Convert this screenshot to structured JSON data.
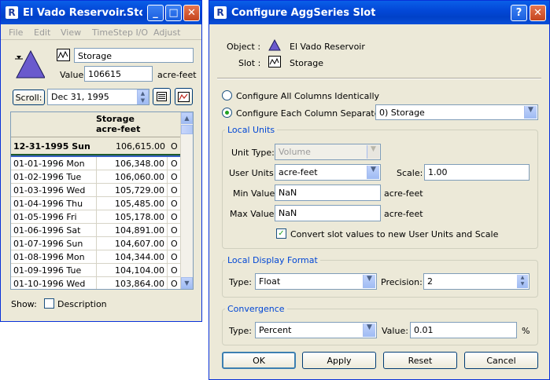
{
  "left_window": {
    "title": "El Vado Reservoir.Stor...",
    "menu": [
      "File",
      "Edit",
      "View",
      "TimeStep I/O",
      "Adjust"
    ],
    "slot_name": "Storage",
    "value_label": "Value:",
    "value": "106615",
    "units": "acre-feet",
    "scroll_label": "Scroll:",
    "scroll_date": "Dec 31, 1995",
    "column_header_line1": "Storage",
    "column_header_line2": "acre-feet",
    "current_row": {
      "date": "12-31-1995 Sun",
      "value": "106,615.00",
      "flag": "O"
    },
    "rows": [
      {
        "date": "01-01-1996 Mon",
        "value": "106,348.00",
        "flag": "O"
      },
      {
        "date": "01-02-1996 Tue",
        "value": "106,060.00",
        "flag": "O"
      },
      {
        "date": "01-03-1996 Wed",
        "value": "105,729.00",
        "flag": "O"
      },
      {
        "date": "01-04-1996 Thu",
        "value": "105,485.00",
        "flag": "O"
      },
      {
        "date": "01-05-1996 Fri",
        "value": "105,178.00",
        "flag": "O"
      },
      {
        "date": "01-06-1996 Sat",
        "value": "104,891.00",
        "flag": "O"
      },
      {
        "date": "01-07-1996 Sun",
        "value": "104,607.00",
        "flag": "O"
      },
      {
        "date": "01-08-1996 Mon",
        "value": "104,344.00",
        "flag": "O"
      },
      {
        "date": "01-09-1996 Tue",
        "value": "104,104.00",
        "flag": "O"
      },
      {
        "date": "01-10-1996 Wed",
        "value": "103,864.00",
        "flag": "O"
      }
    ],
    "show_label": "Show:",
    "description_label": "Description"
  },
  "dialog": {
    "title": "Configure AggSeries Slot",
    "object_label": "Object :",
    "object_value": "El Vado Reservoir",
    "slot_label": "Slot :",
    "slot_value": "Storage",
    "radio_all": "Configure All Columns Identically",
    "radio_each": "Configure Each Column Separately",
    "column_select": "0)  Storage",
    "local_units": {
      "title": "Local Units",
      "unit_type_label": "Unit Type:",
      "unit_type_value": "Volume",
      "user_units_label": "User Units:",
      "user_units_value": "acre-feet",
      "scale_label": "Scale:",
      "scale_value": "1.00",
      "min_label": "Min Value:",
      "min_value": "NaN",
      "min_units": "acre-feet",
      "max_label": "Max Value:",
      "max_value": "NaN",
      "max_units": "acre-feet",
      "convert_label": "Convert slot values to new User Units and Scale"
    },
    "display_format": {
      "title": "Local Display Format",
      "type_label": "Type:",
      "type_value": "Float",
      "precision_label": "Precision:",
      "precision_value": "2"
    },
    "convergence": {
      "title": "Convergence",
      "type_label": "Type:",
      "type_value": "Percent",
      "value_label": "Value:",
      "value_value": "0.01",
      "percent_sign": "%"
    },
    "buttons": {
      "ok": "OK",
      "apply": "Apply",
      "reset": "Reset",
      "cancel": "Cancel"
    }
  },
  "colors": {
    "titlebar": "#0348d8",
    "group_title": "#0046d5",
    "reservoir_triangle": "#6a5acd"
  }
}
